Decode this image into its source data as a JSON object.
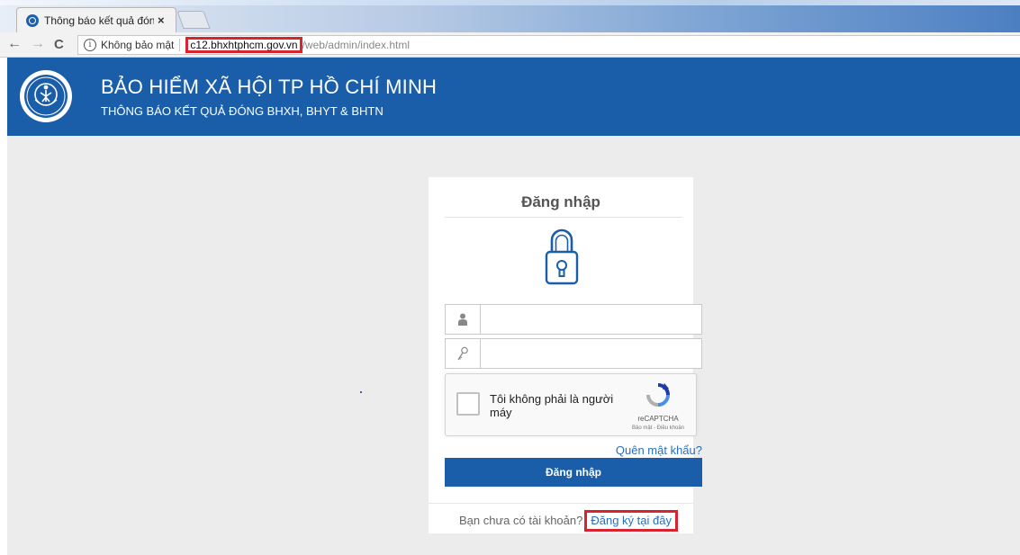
{
  "browser": {
    "tab": {
      "title": "Thông báo kết quả đóng",
      "close": "×"
    },
    "nav": {
      "back": "←",
      "forward": "→",
      "reload": "C"
    },
    "address": {
      "security_label": "Không bảo mật",
      "info_glyph": "i",
      "domain": "c12.bhxhtphcm.gov.vn",
      "path": "/web/admin/index.html"
    }
  },
  "header": {
    "title": "BẢO HIỂM XÃ HỘI TP HỒ CHÍ MINH",
    "subtitle": "THÔNG BÁO KẾT QUẢ ĐÓNG BHXH, BHYT & BHTN"
  },
  "login": {
    "title": "Đăng nhập",
    "username_value": "",
    "password_value": "",
    "captcha": {
      "label": "Tôi không phải là người máy",
      "brand": "reCAPTCHA",
      "terms": "Bảo mật - Điều khoản"
    },
    "forgot_label": "Quên mật khẩu?",
    "submit_label": "Đăng nhập",
    "register_prompt": "Bạn chưa có tài khoản?",
    "register_link": "Đăng ký tại đây"
  },
  "colors": {
    "brand_blue": "#1a5ea9",
    "highlight_red": "#d9232e",
    "link_blue": "#2a6ebb",
    "page_background": "#ececec"
  },
  "icons": [
    "info-icon",
    "lock-icon",
    "user-icon",
    "key-icon",
    "recaptcha-icon",
    "logo-emblem"
  ]
}
